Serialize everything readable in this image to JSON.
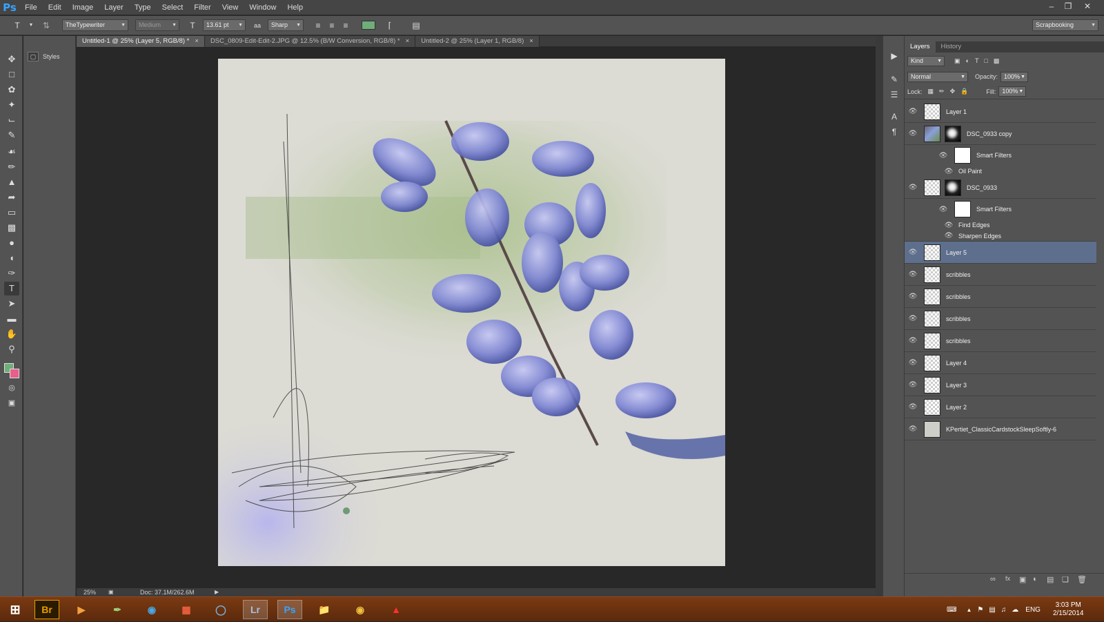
{
  "app": {
    "logo": "Ps"
  },
  "menu": [
    "File",
    "Edit",
    "Image",
    "Layer",
    "Type",
    "Select",
    "Filter",
    "View",
    "Window",
    "Help"
  ],
  "options": {
    "font_family": "TheTypewriter",
    "font_style": "Medium",
    "font_size": "13.61 pt",
    "antialias": "Sharp",
    "text_color": "#6fae7a",
    "workspace": "Scrapbooking"
  },
  "styles_panel": {
    "label": "Styles"
  },
  "tabs": [
    {
      "label": "Untitled-1 @ 25% (Layer 5, RGB/8) *"
    },
    {
      "label": "DSC_0809-Edit-Edit-2.JPG @ 12.5% (B/W Conversion, RGB/8) *"
    },
    {
      "label": "Untitled-2 @ 25% (Layer 1, RGB/8)"
    }
  ],
  "status": {
    "zoom": "25%",
    "doc": "Doc: 37.1M/262.6M"
  },
  "layers_panel": {
    "tabs": [
      "Layers",
      "History"
    ],
    "kind": "Kind",
    "blend": "Normal",
    "opacity_label": "Opacity:",
    "opacity": "100%",
    "lock_label": "Lock:",
    "fill_label": "Fill:",
    "fill": "100%",
    "layers": [
      {
        "name": "Layer 1"
      },
      {
        "name": "DSC_0933 copy"
      },
      {
        "name": "Smart Filters"
      },
      {
        "name": "Oil Paint"
      },
      {
        "name": "DSC_0933"
      },
      {
        "name": "Smart Filters"
      },
      {
        "name": "Find Edges"
      },
      {
        "name": "Sharpen Edges"
      },
      {
        "name": "Layer 5"
      },
      {
        "name": "scribbles"
      },
      {
        "name": "scribbles"
      },
      {
        "name": "scribbles"
      },
      {
        "name": "scribbles"
      },
      {
        "name": "Layer 4"
      },
      {
        "name": "Layer 3"
      },
      {
        "name": "Layer 2"
      },
      {
        "name": "KPertiet_ClassicCardstockSleepSoftly-6"
      }
    ]
  },
  "taskbar": {
    "apps": [
      "Br",
      "Lr",
      "Ps"
    ],
    "lang": "ENG",
    "time": "3:03 PM",
    "date": "2/15/2014"
  },
  "colors": {
    "foreground": "#6fae7a",
    "background": "#e8608a",
    "selected_layer": "#5d6f8c"
  }
}
